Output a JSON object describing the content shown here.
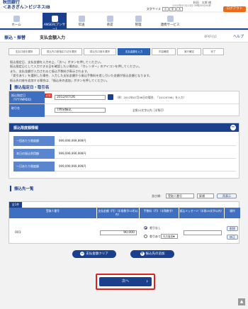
{
  "header": {
    "bank_name": "秋田銀行",
    "service_name": "＜あきぎん＞ビジネスIB",
    "user": "秋田　太郎 様",
    "last_login": "2012年07月13日 09時30分00秒",
    "font_size_label": "文字サイズ",
    "font_sizes": [
      "小",
      "中",
      "大"
    ],
    "logout_label": "ログアウト"
  },
  "nav": [
    {
      "label": "ホーム",
      "icon": "home-icon"
    },
    {
      "label": "ANSER(アンサー)",
      "icon": "anser-icon"
    },
    {
      "label": "伝送",
      "icon": "transfer-icon"
    },
    {
      "label": "承認",
      "icon": "approve-icon"
    },
    {
      "label": "管理",
      "icon": "admin-icon"
    },
    {
      "label": "連携サービス",
      "icon": "link-icon"
    }
  ],
  "titlebar": {
    "category": "振込・振替",
    "title": "支払金額入力",
    "screen_id": "BFKF011",
    "help_label": "ヘルプ"
  },
  "steps": [
    "支払口座を選択",
    "振込先口座指定方法を選択",
    "振込先口座を選択",
    "支払金額を入力",
    "内容確認",
    "実行確定",
    "完了"
  ],
  "instructions": [
    "振込指定日、支払金額を入力の上、「次へ」ボタンを押してください。",
    "振込指定日として入力できる日を確認したい場合は、「カレンダー」のアイコンを押してください。",
    "また、支払金額が入力されると振込手数料が表示されます。",
    "「差引あり」を選択した場合、入力した支払金額から振込手数料を差し引いた金額が振込金額となります。",
    "振込先口座を追加する場合は、「振込先の追加」ボタンを押してください。"
  ],
  "date_section": {
    "title": "振込指定日・取引名",
    "date_label": "振込指定日（YYYYMMDD）",
    "required_label": "必須",
    "date_value": "2012/07/26",
    "date_note": "（例：2012年07月06日の場合、「20120706」を入力）",
    "name_label": "取引名",
    "name_value": "7月分振込",
    "name_note": "全角10文字以内［半角可］"
  },
  "limits": {
    "title": "振込限度額情報",
    "rows": [
      {
        "label": "一回あたり限度額",
        "value": "999,999,999,999円"
      },
      {
        "label": "本日の振込利用額",
        "value": "999,999,999,999円"
      },
      {
        "label": "一日あたり限度額",
        "value": "999,999,999,999円"
      }
    ]
  },
  "payee": {
    "title": "振込先一覧",
    "sort_label": "並び順：",
    "sort_value": "受取人番号",
    "order_value": "昇順",
    "resort_label": "再表示",
    "count_label": "全1件",
    "columns": [
      "受取人番号",
      "支払金額（円）（半角数字11桁以内）",
      "手数料（円）（半角数字）",
      "振込メッセージ（半角20文字以内）",
      "操作"
    ],
    "rows": [
      {
        "id": "001",
        "amount": "90,000",
        "fee_option_1": "差引なし",
        "fee_option_2": "差引あり",
        "fee_option_2_select": "先方負担",
        "fee_option_2_arrow": "▼",
        "ops": [
          "削除",
          "修正"
        ]
      }
    ],
    "clear_label": "支払金額クリア",
    "add_label": "振込先の追加"
  },
  "next_label": "次へ",
  "pagetop_label": "▲"
}
